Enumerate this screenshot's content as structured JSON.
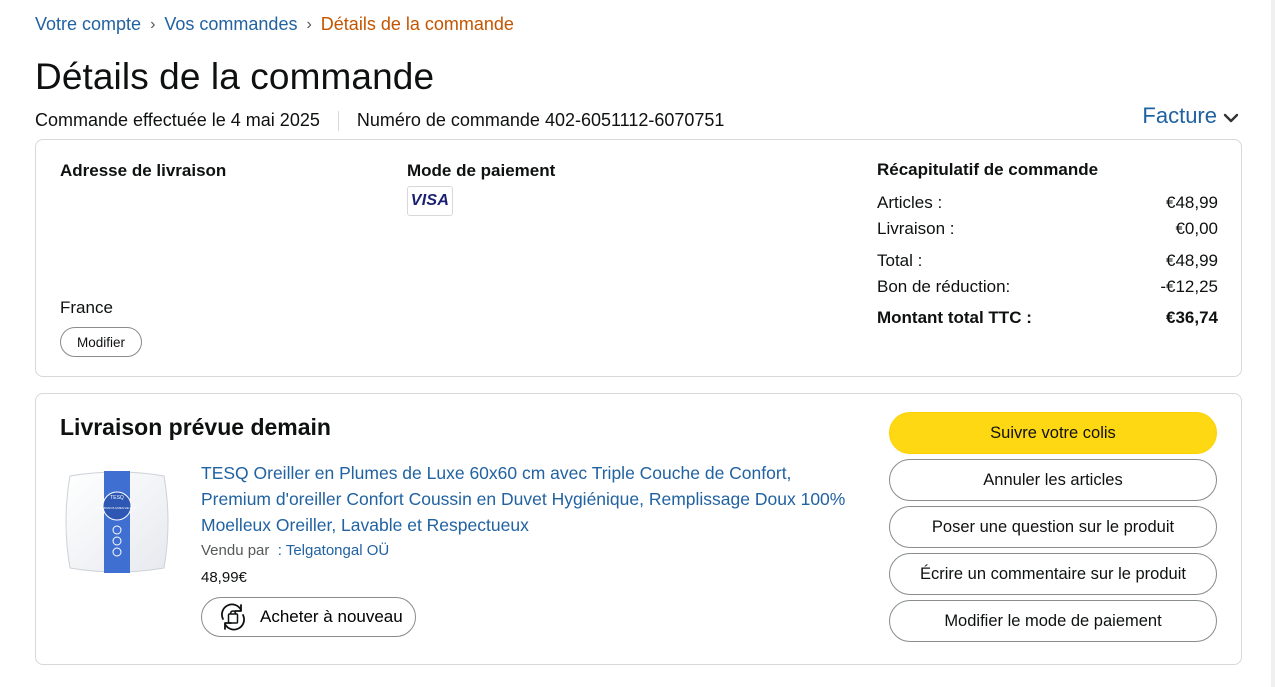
{
  "breadcrumb": {
    "account": "Votre compte",
    "orders": "Vos commandes",
    "current": "Détails de la commande",
    "separator": "›"
  },
  "page": {
    "title": "Détails de la commande",
    "order_date": "Commande effectuée le 4 mai 2025",
    "order_number": "Numéro de commande 402-6051112-6070751",
    "invoice_label": "Facture"
  },
  "shipping": {
    "title": "Adresse de livraison",
    "country": "France",
    "modify_label": "Modifier"
  },
  "payment": {
    "title": "Mode de paiement",
    "card_brand": "VISA"
  },
  "summary": {
    "title": "Récapitulatif de commande",
    "rows": [
      {
        "label": "Articles :",
        "value": "€48,99"
      },
      {
        "label": "Livraison :",
        "value": "€0,00"
      },
      {
        "label": "Total :",
        "value": "€48,99"
      },
      {
        "label": "Bon de réduction:",
        "value": "-€12,25"
      },
      {
        "label": "Montant total TTC :",
        "value": "€36,74"
      }
    ]
  },
  "delivery": {
    "title": "Livraison prévue demain",
    "product": {
      "title": "TESQ Oreiller en Plumes de Luxe 60x60 cm avec Triple Couche de Confort, Premium d'oreiller Confort Coussin en Duvet Hygiénique, Remplissage Doux 100% Moelleux Oreiller, Lavable et Respectueux",
      "sold_by_label": "Vendu par",
      "seller_name": ": Telgatongal OÜ",
      "price": "48,99€",
      "buy_again_label": "Acheter à nouveau",
      "image_brand": "TESQ",
      "image_caption": "PREMIUM PLUMES DE LUXE"
    },
    "actions": [
      {
        "label": "Suivre votre colis",
        "primary": true
      },
      {
        "label": "Annuler les articles"
      },
      {
        "label": "Poser une question sur le produit"
      },
      {
        "label": "Écrire un commentaire sur le produit"
      },
      {
        "label": "Modifier le mode de paiement"
      }
    ]
  },
  "colors": {
    "link": "#2162a1",
    "breadcrumb_current": "#c45500",
    "primary_button": "#ffd814",
    "border": "#d5d9d9",
    "visa_blue": "#1a1f71"
  },
  "icons": {
    "invoice_chevron": "chevron-down-icon",
    "buy_again": "refresh-bag-icon"
  }
}
